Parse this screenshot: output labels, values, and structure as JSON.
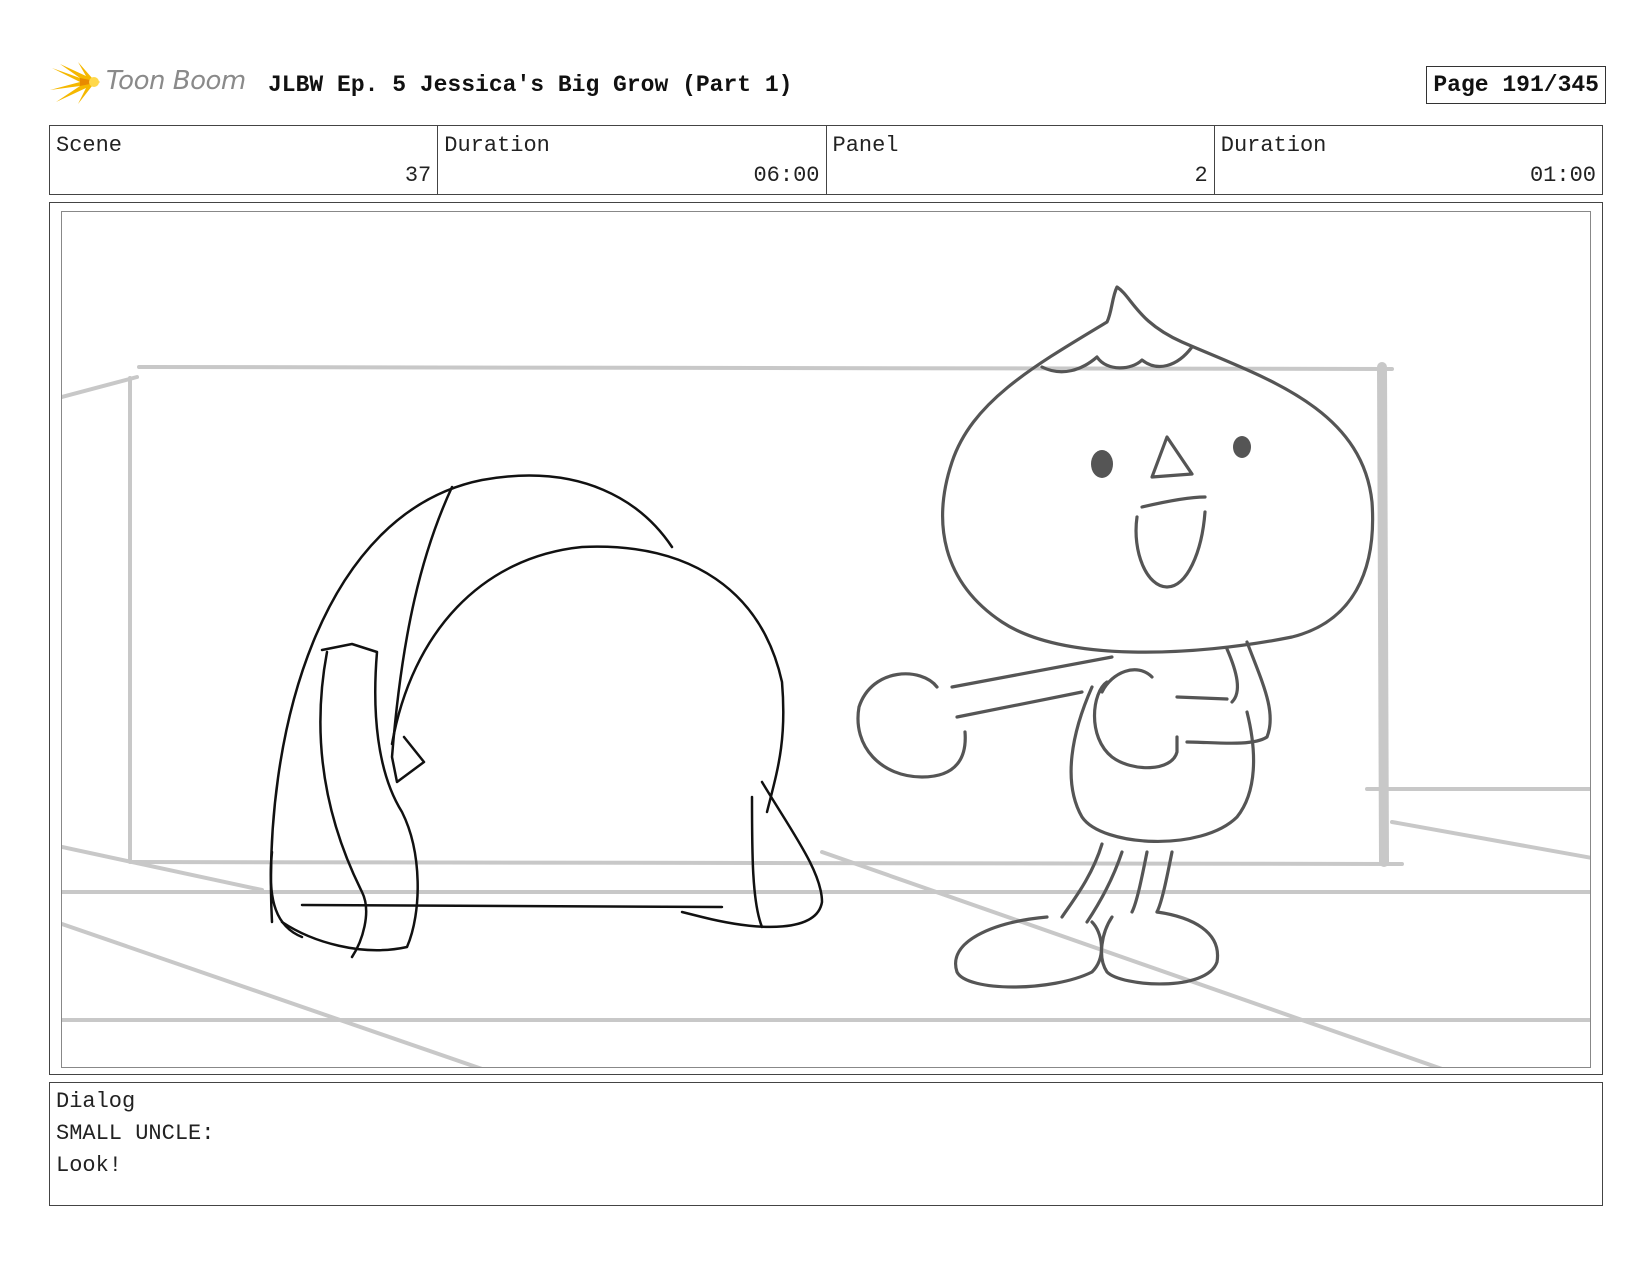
{
  "header": {
    "logo_text": "Toon Boom",
    "title": "JLBW Ep. 5 Jessica's Big Grow (Part 1)",
    "page": "Page 191/345"
  },
  "info": {
    "scene_label": "Scene",
    "scene_value": "37",
    "scene_duration_label": "Duration",
    "scene_duration_value": "06:00",
    "panel_label": "Panel",
    "panel_value": "2",
    "panel_duration_label": "Duration",
    "panel_duration_value": "01:00"
  },
  "panel": {
    "image": "storyboard-sketch"
  },
  "dialog": {
    "label": "Dialog",
    "character": "SMALL UNCLE:",
    "line": "Look!"
  },
  "colors": {
    "logo_accent": "#f5b800",
    "frame": "#444444",
    "sketch_bg": "#c8c8c8",
    "sketch_fg": "#555555"
  }
}
